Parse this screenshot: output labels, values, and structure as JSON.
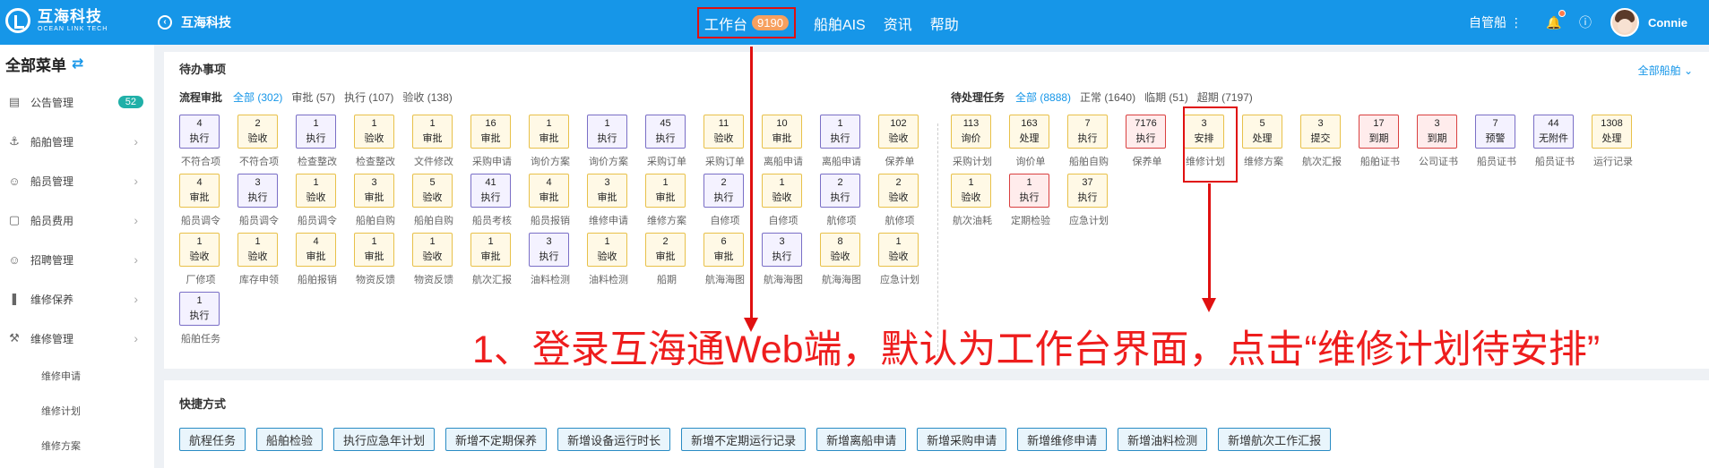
{
  "header": {
    "logo_cn": "互海科技",
    "logo_en": "OCEAN LINK TECH",
    "back_label": "互海科技",
    "nav": [
      {
        "label": "工作台",
        "badge": "9190"
      },
      {
        "label": "船舶AIS"
      },
      {
        "label": "资讯"
      },
      {
        "label": "帮助"
      }
    ],
    "self_manage": "自管船",
    "user": "Connie"
  },
  "sidebar": {
    "title": "全部菜单",
    "items": [
      {
        "label": "公告管理",
        "icon": "book-icon",
        "badge": "52"
      },
      {
        "label": "船舶管理",
        "icon": "anchor-icon"
      },
      {
        "label": "船员管理",
        "icon": "person-icon"
      },
      {
        "label": "船员费用",
        "icon": "wallet-icon"
      },
      {
        "label": "招聘管理",
        "icon": "person-icon"
      },
      {
        "label": "维修保养",
        "icon": "tool-icon"
      },
      {
        "label": "维修管理",
        "icon": "wrench-icon"
      }
    ],
    "subitems": [
      "维修申请",
      "维修计划",
      "维修方案"
    ]
  },
  "todo": {
    "title": "待办事项",
    "all_ships": "全部船舶",
    "flow": {
      "title": "流程审批",
      "filters": [
        "全部 (302)",
        "审批 (57)",
        "执行 (107)",
        "验收 (138)"
      ],
      "tiles": [
        {
          "n": "4",
          "s": "执行",
          "c": "不符合项",
          "t": "p"
        },
        {
          "n": "2",
          "s": "验收",
          "c": "不符合项",
          "t": "y"
        },
        {
          "n": "1",
          "s": "执行",
          "c": "检查整改",
          "t": "p"
        },
        {
          "n": "1",
          "s": "验收",
          "c": "检查整改",
          "t": "y"
        },
        {
          "n": "1",
          "s": "审批",
          "c": "文件修改",
          "t": "y"
        },
        {
          "n": "16",
          "s": "审批",
          "c": "采购申请",
          "t": "y"
        },
        {
          "n": "1",
          "s": "审批",
          "c": "询价方案",
          "t": "y"
        },
        {
          "n": "1",
          "s": "执行",
          "c": "询价方案",
          "t": "p"
        },
        {
          "n": "45",
          "s": "执行",
          "c": "采购订单",
          "t": "p"
        },
        {
          "n": "11",
          "s": "验收",
          "c": "采购订单",
          "t": "y"
        },
        {
          "n": "10",
          "s": "审批",
          "c": "离船申请",
          "t": "y"
        },
        {
          "n": "1",
          "s": "执行",
          "c": "离船申请",
          "t": "p"
        },
        {
          "n": "102",
          "s": "验收",
          "c": "保养单",
          "t": "y"
        },
        {
          "n": "4",
          "s": "审批",
          "c": "船员调令",
          "t": "y"
        },
        {
          "n": "3",
          "s": "执行",
          "c": "船员调令",
          "t": "p"
        },
        {
          "n": "1",
          "s": "验收",
          "c": "船员调令",
          "t": "y"
        },
        {
          "n": "3",
          "s": "审批",
          "c": "船舶自购",
          "t": "y"
        },
        {
          "n": "5",
          "s": "验收",
          "c": "船舶自购",
          "t": "y"
        },
        {
          "n": "41",
          "s": "执行",
          "c": "船员考核",
          "t": "p"
        },
        {
          "n": "4",
          "s": "审批",
          "c": "船员报销",
          "t": "y"
        },
        {
          "n": "3",
          "s": "审批",
          "c": "维修申请",
          "t": "y"
        },
        {
          "n": "1",
          "s": "审批",
          "c": "维修方案",
          "t": "y"
        },
        {
          "n": "2",
          "s": "执行",
          "c": "自修项",
          "t": "p"
        },
        {
          "n": "1",
          "s": "验收",
          "c": "自修项",
          "t": "y"
        },
        {
          "n": "2",
          "s": "执行",
          "c": "航修项",
          "t": "p"
        },
        {
          "n": "2",
          "s": "验收",
          "c": "航修项",
          "t": "y"
        },
        {
          "n": "1",
          "s": "验收",
          "c": "厂修项",
          "t": "y"
        },
        {
          "n": "1",
          "s": "验收",
          "c": "库存申领",
          "t": "y"
        },
        {
          "n": "4",
          "s": "审批",
          "c": "船舶报销",
          "t": "y"
        },
        {
          "n": "1",
          "s": "审批",
          "c": "物资反馈",
          "t": "y"
        },
        {
          "n": "1",
          "s": "验收",
          "c": "物资反馈",
          "t": "y"
        },
        {
          "n": "1",
          "s": "审批",
          "c": "航次汇报",
          "t": "y"
        },
        {
          "n": "3",
          "s": "执行",
          "c": "油料检测",
          "t": "p"
        },
        {
          "n": "1",
          "s": "验收",
          "c": "油料检测",
          "t": "y"
        },
        {
          "n": "2",
          "s": "审批",
          "c": "船期",
          "t": "y"
        },
        {
          "n": "6",
          "s": "审批",
          "c": "航海海图",
          "t": "y"
        },
        {
          "n": "3",
          "s": "执行",
          "c": "航海海图",
          "t": "p"
        },
        {
          "n": "8",
          "s": "验收",
          "c": "航海海图",
          "t": "y"
        },
        {
          "n": "1",
          "s": "验收",
          "c": "应急计划",
          "t": "y"
        },
        {
          "n": "1",
          "s": "执行",
          "c": "船舶任务",
          "t": "p"
        }
      ]
    },
    "pending": {
      "title": "待处理任务",
      "filters": [
        "全部 (8888)",
        "正常 (1640)",
        "临期 (51)",
        "超期 (7197)"
      ],
      "tiles": [
        {
          "n": "113",
          "s": "询价",
          "c": "采购计划",
          "t": "y"
        },
        {
          "n": "163",
          "s": "处理",
          "c": "询价单",
          "t": "y"
        },
        {
          "n": "7",
          "s": "执行",
          "c": "船舶自购",
          "t": "y"
        },
        {
          "n": "7176",
          "s": "执行",
          "c": "保养单",
          "t": "r"
        },
        {
          "n": "3",
          "s": "安排",
          "c": "维修计划",
          "t": "y"
        },
        {
          "n": "5",
          "s": "处理",
          "c": "维修方案",
          "t": "y"
        },
        {
          "n": "3",
          "s": "提交",
          "c": "航次汇报",
          "t": "y"
        },
        {
          "n": "17",
          "s": "到期",
          "c": "船舶证书",
          "t": "r"
        },
        {
          "n": "3",
          "s": "到期",
          "c": "公司证书",
          "t": "r"
        },
        {
          "n": "7",
          "s": "预警",
          "c": "船员证书",
          "t": "p"
        },
        {
          "n": "44",
          "s": "无附件",
          "c": "船员证书",
          "t": "p"
        },
        {
          "n": "1308",
          "s": "处理",
          "c": "运行记录",
          "t": "y"
        },
        {
          "n": "1",
          "s": "验收",
          "c": "航次油耗",
          "t": "y"
        },
        {
          "n": "1",
          "s": "执行",
          "c": "定期检验",
          "t": "r"
        },
        {
          "n": "37",
          "s": "执行",
          "c": "应急计划",
          "t": "y"
        }
      ]
    }
  },
  "annotation": "1、登录互海通Web端，默认为工作台界面，点击“维修计划待安排”",
  "quick": {
    "title": "快捷方式",
    "buttons": [
      "航程任务",
      "船舶检验",
      "执行应急年计划",
      "新增不定期保养",
      "新增设备运行时长",
      "新增不定期运行记录",
      "新增离船申请",
      "新增采购申请",
      "新增维修申请",
      "新增油料检测",
      "新增航次工作汇报"
    ]
  },
  "colors": {
    "header": "#1696e8",
    "annotation": "#e01010",
    "tile_yellow": "#e8c14a",
    "tile_purple": "#7a6fc6",
    "tile_red": "#d94040"
  }
}
